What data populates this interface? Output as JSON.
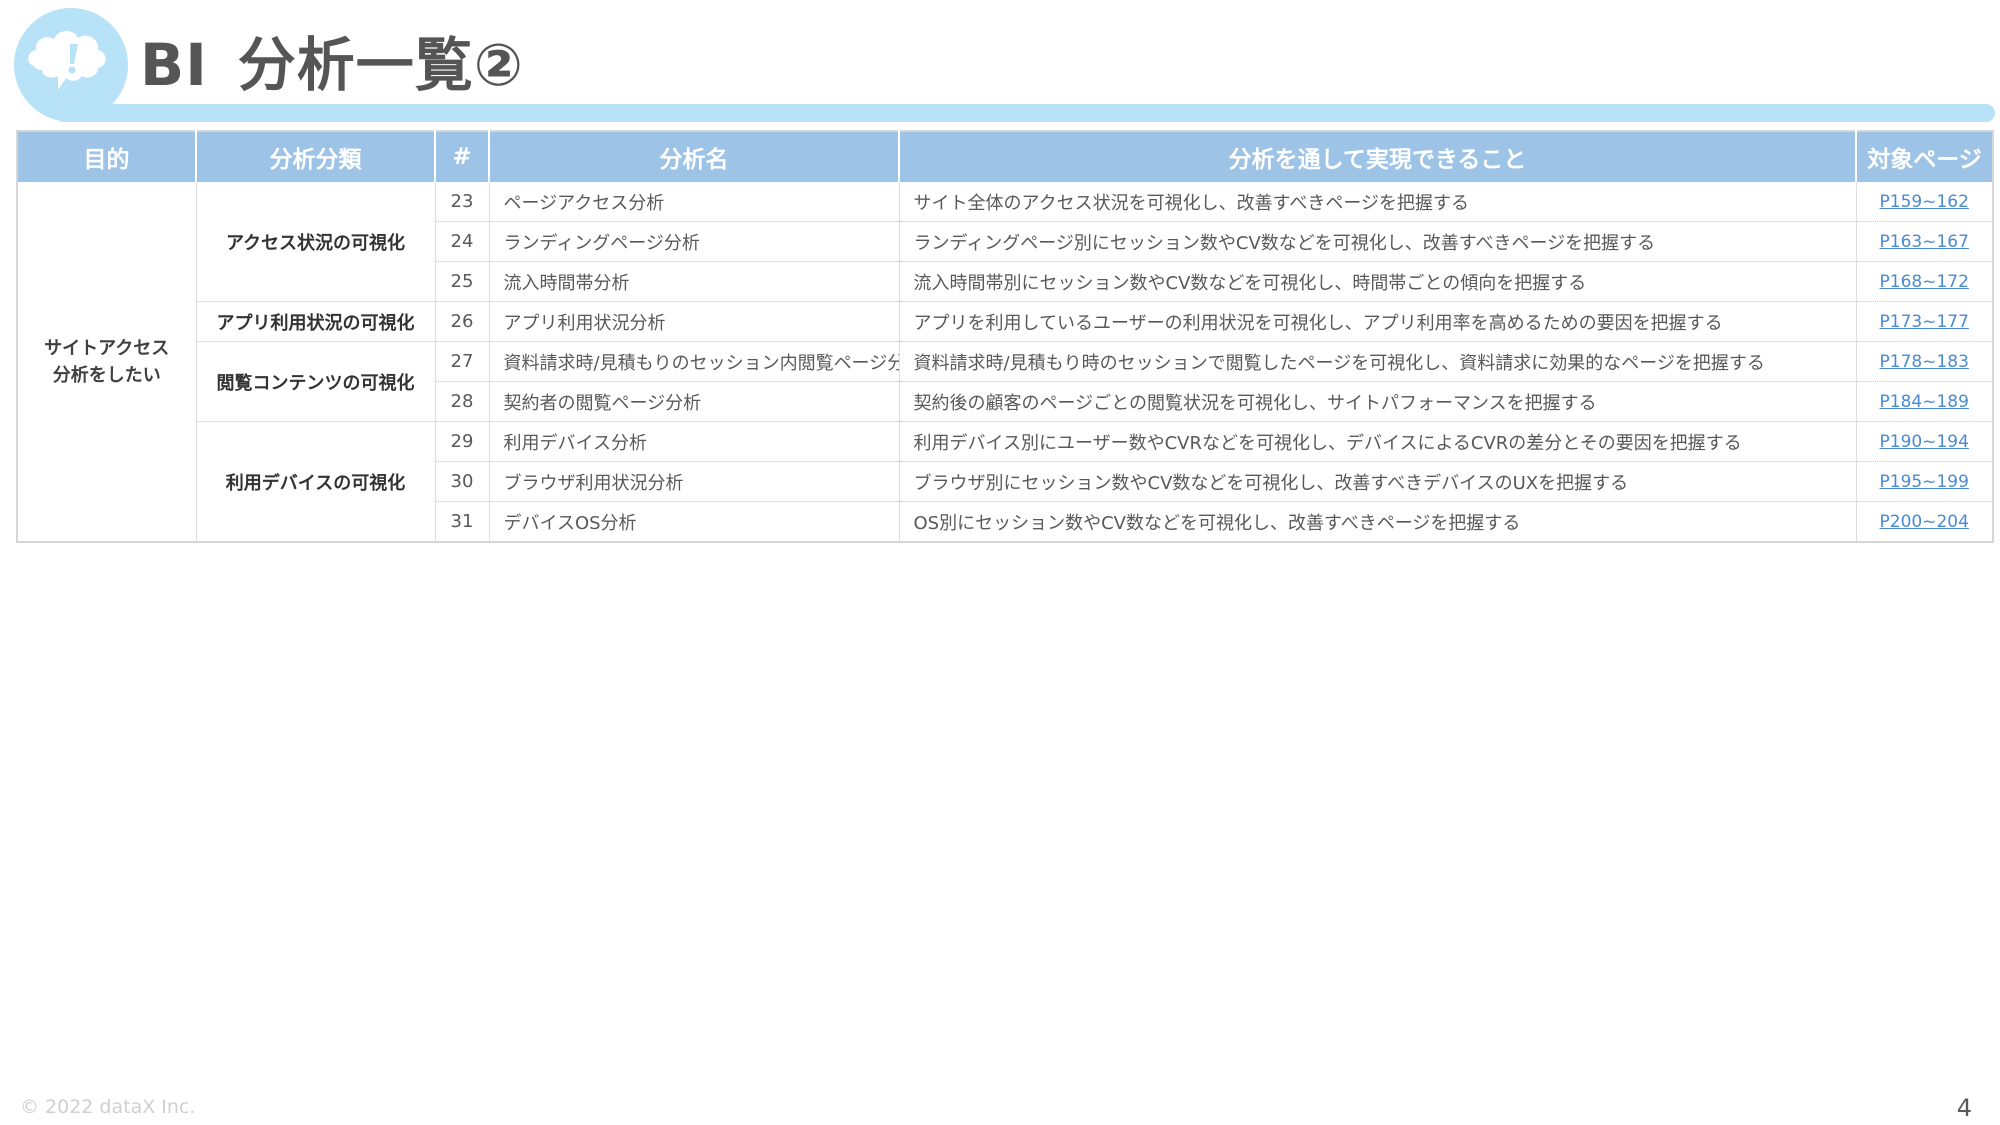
{
  "header": {
    "title_prefix": "BI",
    "title_main": "分析一覧②"
  },
  "table": {
    "columns": [
      "目的",
      "分析分類",
      "#",
      "分析名",
      "分析を通して実現できること",
      "対象ページ"
    ],
    "purpose": {
      "line1": "サイトアクセス",
      "line2": "分析をしたい"
    },
    "categories": [
      "アクセス状況の可視化",
      "アプリ利用状況の可視化",
      "閲覧コンテンツの可視化",
      "利用デバイスの可視化"
    ],
    "rows": [
      {
        "num": "23",
        "name": "ページアクセス分析",
        "desc": "サイト全体のアクセス状況を可視化し、改善すべきページを把握する",
        "page": "P159~162"
      },
      {
        "num": "24",
        "name": "ランディングページ分析",
        "desc": "ランディングページ別にセッション数やCV数などを可視化し、改善すべきページを把握する",
        "page": "P163~167"
      },
      {
        "num": "25",
        "name": "流入時間帯分析",
        "desc": "流入時間帯別にセッション数やCV数などを可視化し、時間帯ごとの傾向を把握する",
        "page": "P168~172"
      },
      {
        "num": "26",
        "name": "アプリ利用状況分析",
        "desc": "アプリを利用しているユーザーの利用状況を可視化し、アプリ利用率を高めるための要因を把握する",
        "page": "P173~177"
      },
      {
        "num": "27",
        "name": "資料請求時/見積もりのセッション内閲覧ページ分析",
        "desc": "資料請求時/見積もり時のセッションで閲覧したページを可視化し、資料請求に効果的なページを把握する",
        "page": "P178~183"
      },
      {
        "num": "28",
        "name": "契約者の閲覧ページ分析",
        "desc": "契約後の顧客のページごとの閲覧状況を可視化し、サイトパフォーマンスを把握する",
        "page": "P184~189"
      },
      {
        "num": "29",
        "name": "利用デバイス分析",
        "desc": "利用デバイス別にユーザー数やCVRなどを可視化し、デバイスによるCVRの差分とその要因を把握する",
        "page": "P190~194"
      },
      {
        "num": "30",
        "name": "ブラウザ利用状況分析",
        "desc": "ブラウザ別にセッション数やCV数などを可視化し、改善すべきデバイスのUXを把握する",
        "page": "P195~199"
      },
      {
        "num": "31",
        "name": "デバイスOS分析",
        "desc": "OS別にセッション数やCV数などを可視化し、改善すべきページを把握する",
        "page": "P200~204"
      }
    ]
  },
  "footer": {
    "copyright": "© 2022 dataX Inc.",
    "page_number": "4"
  },
  "colors": {
    "header_bg": "#9dc3e6",
    "accent_bar": "#b7e2f8",
    "link": "#4a8ad4"
  },
  "icons": [
    "thought-bubble-exclamation-icon"
  ]
}
